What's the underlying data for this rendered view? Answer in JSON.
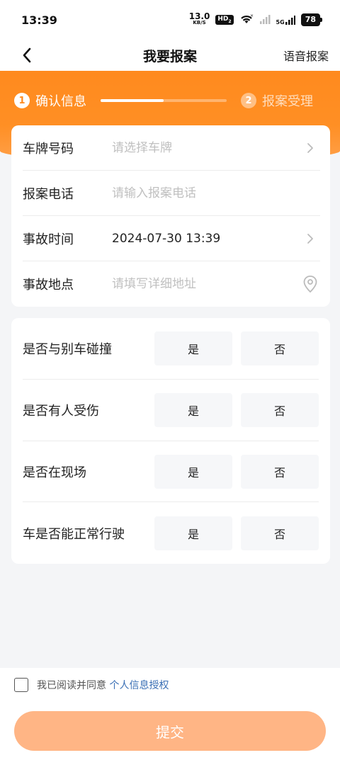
{
  "status_bar": {
    "time": "13:39",
    "net_speed": "13.0",
    "net_unit": "KB/S",
    "hd": "HD",
    "hd_sub": "2",
    "network": "5G",
    "battery": "78"
  },
  "nav": {
    "title": "我要报案",
    "action_label": "语音报案"
  },
  "steps": [
    {
      "number": "1",
      "label": "确认信息"
    },
    {
      "number": "2",
      "label": "报案受理"
    }
  ],
  "step_progress": 0.5,
  "info_rows": [
    {
      "label": "车牌号码",
      "placeholder": "请选择车牌",
      "value": "",
      "icon": "chevron-right-icon"
    },
    {
      "label": "报案电话",
      "placeholder": "请输入报案电话",
      "value": "",
      "icon": ""
    },
    {
      "label": "事故时间",
      "placeholder": "",
      "value": "2024-07-30 13:39",
      "icon": "chevron-right-icon"
    },
    {
      "label": "事故地点",
      "placeholder": "请填写详细地址",
      "value": "",
      "icon": "location-pin-icon"
    }
  ],
  "questions": [
    {
      "label": "是否与别车碰撞",
      "yes": "是",
      "no": "否"
    },
    {
      "label": "是否有人受伤",
      "yes": "是",
      "no": "否"
    },
    {
      "label": "是否在现场",
      "yes": "是",
      "no": "否"
    },
    {
      "label": "车是否能正常行驶",
      "yes": "是",
      "no": "否"
    }
  ],
  "agreement": {
    "text": "我已阅读并同意",
    "link": "个人信息授权"
  },
  "submit_label": "提交",
  "colors": {
    "accent": "#ff8a1e",
    "submit_bg": "#ffb585",
    "link": "#3a6fb5"
  }
}
